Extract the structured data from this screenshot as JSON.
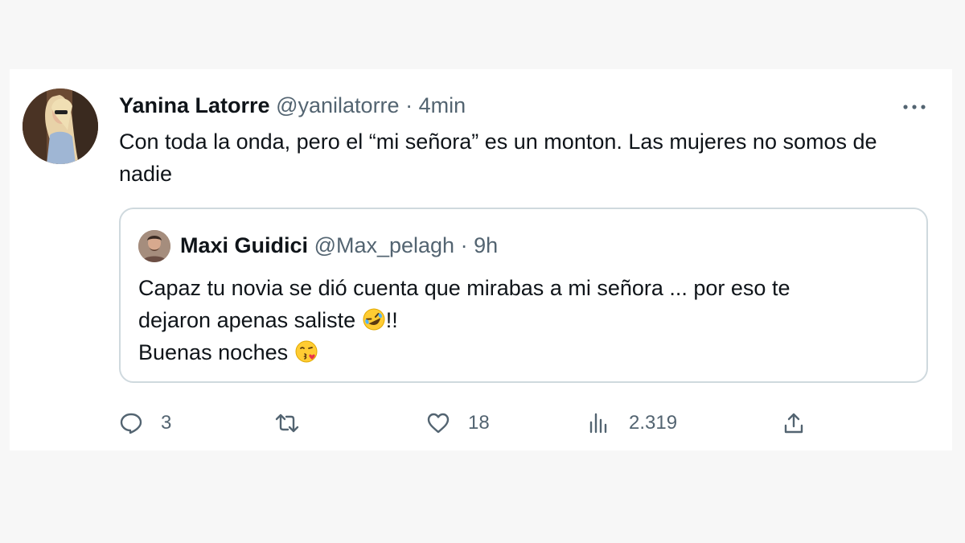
{
  "tweet": {
    "author": {
      "display_name": "Yanina Latorre",
      "handle": "@yanilatorre"
    },
    "separator": "·",
    "time": "4min",
    "text": "Con toda la onda, pero el “mi señora” es un monton. Las mujeres no somos de nadie",
    "more_icon": "more-horizontal-icon"
  },
  "quoted_tweet": {
    "author": {
      "display_name": "Maxi Guidici",
      "handle": "@Max_pelagh"
    },
    "separator": "·",
    "time": "9h",
    "line1": "Capaz tu novia se dió cuenta que mirabas a mi señora ... por eso te",
    "line2_text": "dejaron apenas saliste ",
    "line2_emoji": "rolling-on-floor-laughing-emoji",
    "line2_suffix": "!!",
    "line3_text": "Buenas noches ",
    "line3_emoji": "face-blowing-kiss-emoji"
  },
  "actions": {
    "reply": {
      "icon": "reply-icon",
      "count": "3"
    },
    "retweet": {
      "icon": "retweet-icon",
      "count": ""
    },
    "like": {
      "icon": "heart-icon",
      "count": "18"
    },
    "views": {
      "icon": "views-chart-icon",
      "count": "2.319"
    },
    "share": {
      "icon": "share-icon",
      "count": ""
    }
  },
  "colors": {
    "text_primary": "#0f1419",
    "text_secondary": "#536471",
    "border": "#cfd9de",
    "background": "#f7f7f7",
    "card": "#ffffff"
  }
}
